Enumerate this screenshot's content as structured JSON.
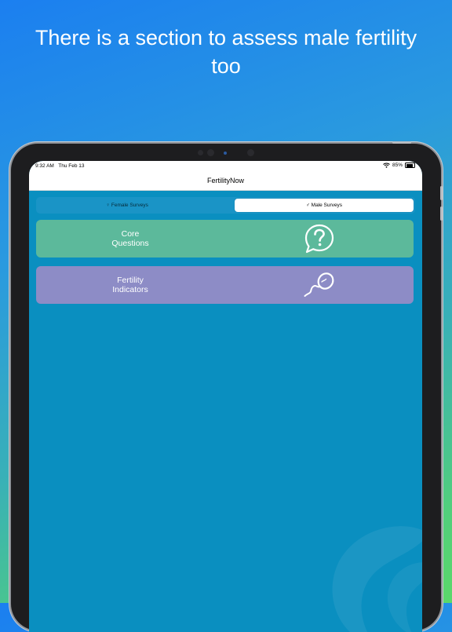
{
  "headline": {
    "line1": "There is a section to assess male fertility",
    "line2": "too"
  },
  "status_bar": {
    "time": "9:32 AM",
    "date": "Thu Feb 13",
    "wifi_icon": "wifi-icon",
    "battery_percent": "85%",
    "battery_level": 0.85
  },
  "nav": {
    "title": "FertilityNow"
  },
  "segmented_control": {
    "female": {
      "symbol": "♀",
      "label": "Female Surveys",
      "selected": false
    },
    "male": {
      "symbol": "♂",
      "label": "Male Surveys",
      "selected": true
    }
  },
  "cards": [
    {
      "line1": "Core",
      "line2": "Questions",
      "icon": "question-speech-bubble-icon",
      "color": "#5cb99b"
    },
    {
      "line1": "Fertility",
      "line2": "Indicators",
      "icon": "sperm-icon",
      "color": "#8d8cc6"
    }
  ],
  "colors": {
    "screen_background": "#0a8fc0",
    "segment_background": "#1a94c6"
  }
}
